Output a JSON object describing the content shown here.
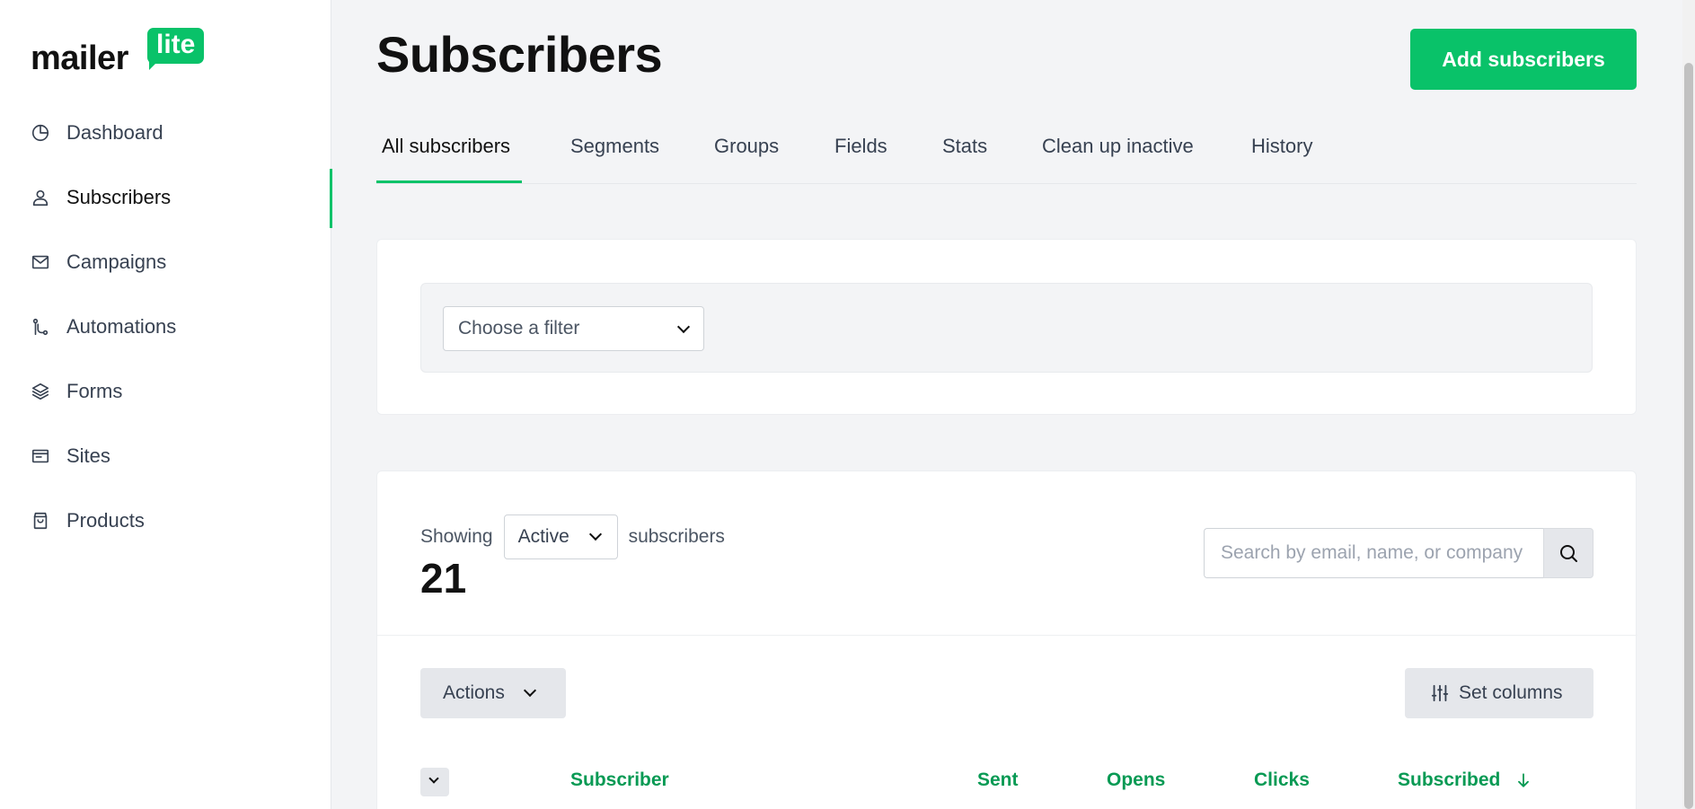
{
  "logo": {
    "word": "mailer",
    "badge": "lite"
  },
  "sidebar": {
    "items": [
      {
        "label": "Dashboard",
        "icon": "dashboard-icon"
      },
      {
        "label": "Subscribers",
        "icon": "user-icon",
        "active": true
      },
      {
        "label": "Campaigns",
        "icon": "mail-icon"
      },
      {
        "label": "Automations",
        "icon": "automation-icon"
      },
      {
        "label": "Forms",
        "icon": "layers-icon"
      },
      {
        "label": "Sites",
        "icon": "browser-icon"
      },
      {
        "label": "Products",
        "icon": "bag-icon"
      }
    ]
  },
  "header": {
    "title": "Subscribers",
    "add_button": "Add subscribers"
  },
  "tabs": [
    {
      "label": "All subscribers",
      "active": true
    },
    {
      "label": "Segments"
    },
    {
      "label": "Groups"
    },
    {
      "label": "Fields"
    },
    {
      "label": "Stats"
    },
    {
      "label": "Clean up inactive"
    },
    {
      "label": "History"
    }
  ],
  "filter": {
    "placeholder": "Choose a filter"
  },
  "list": {
    "showing_label": "Showing",
    "status_value": "Active",
    "subscribers_label": "subscribers",
    "count": "21",
    "search_placeholder": "Search by email, name, or company",
    "actions_label": "Actions",
    "set_columns_label": "Set columns",
    "columns": [
      "Subscriber",
      "Sent",
      "Opens",
      "Clicks",
      "Subscribed"
    ]
  },
  "colors": {
    "accent": "#09c269",
    "column_header": "#089a54"
  }
}
